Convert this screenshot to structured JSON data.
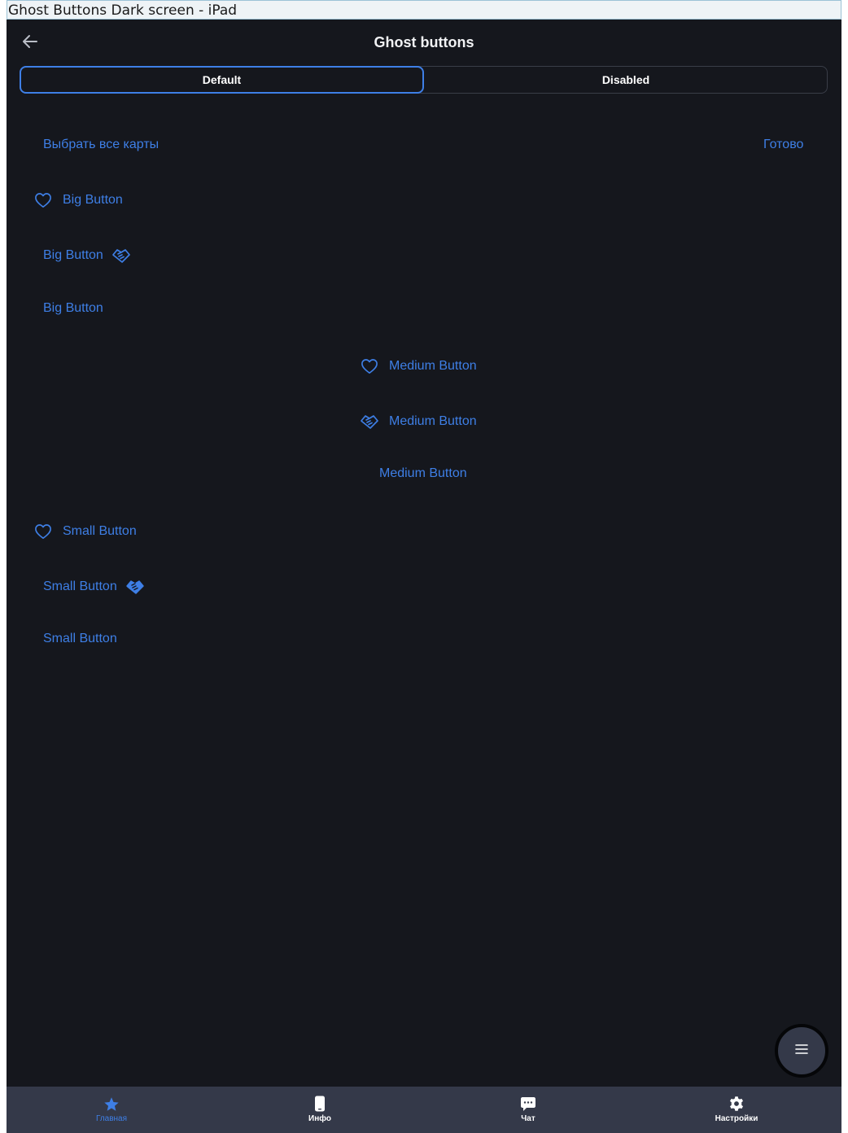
{
  "window": {
    "title": "Ghost Buttons Dark screen - iPad"
  },
  "header": {
    "title": "Ghost buttons",
    "back_icon": "arrow-left-icon"
  },
  "segmented": {
    "default_label": "Default",
    "disabled_label": "Disabled"
  },
  "toolbar": {
    "select_all": "Выбрать все карты",
    "done": "Готово"
  },
  "buttons": {
    "big_left_icon": "Big Button",
    "big_right_icon": "Big Button",
    "big_text_only": "Big Button",
    "medium_heart": "Medium Button",
    "medium_handshake": "Medium Button",
    "medium_text_only": "Medium Button",
    "small_left_icon": "Small Button",
    "small_right_icon": "Small Button",
    "small_text_only": "Small Button"
  },
  "fab": {
    "icon": "menu-icon"
  },
  "tabbar": {
    "items": [
      {
        "label": "Главная",
        "icon": "star-icon",
        "active": true
      },
      {
        "label": "Инфо",
        "icon": "phone-icon",
        "active": false
      },
      {
        "label": "Чат",
        "icon": "chat-icon",
        "active": false
      },
      {
        "label": "Настройки",
        "icon": "gear-icon",
        "active": false
      }
    ]
  },
  "colors": {
    "background": "#15171d",
    "accent": "#3e7fe6",
    "tabbar": "#343949",
    "text": "#f1f2f4"
  }
}
